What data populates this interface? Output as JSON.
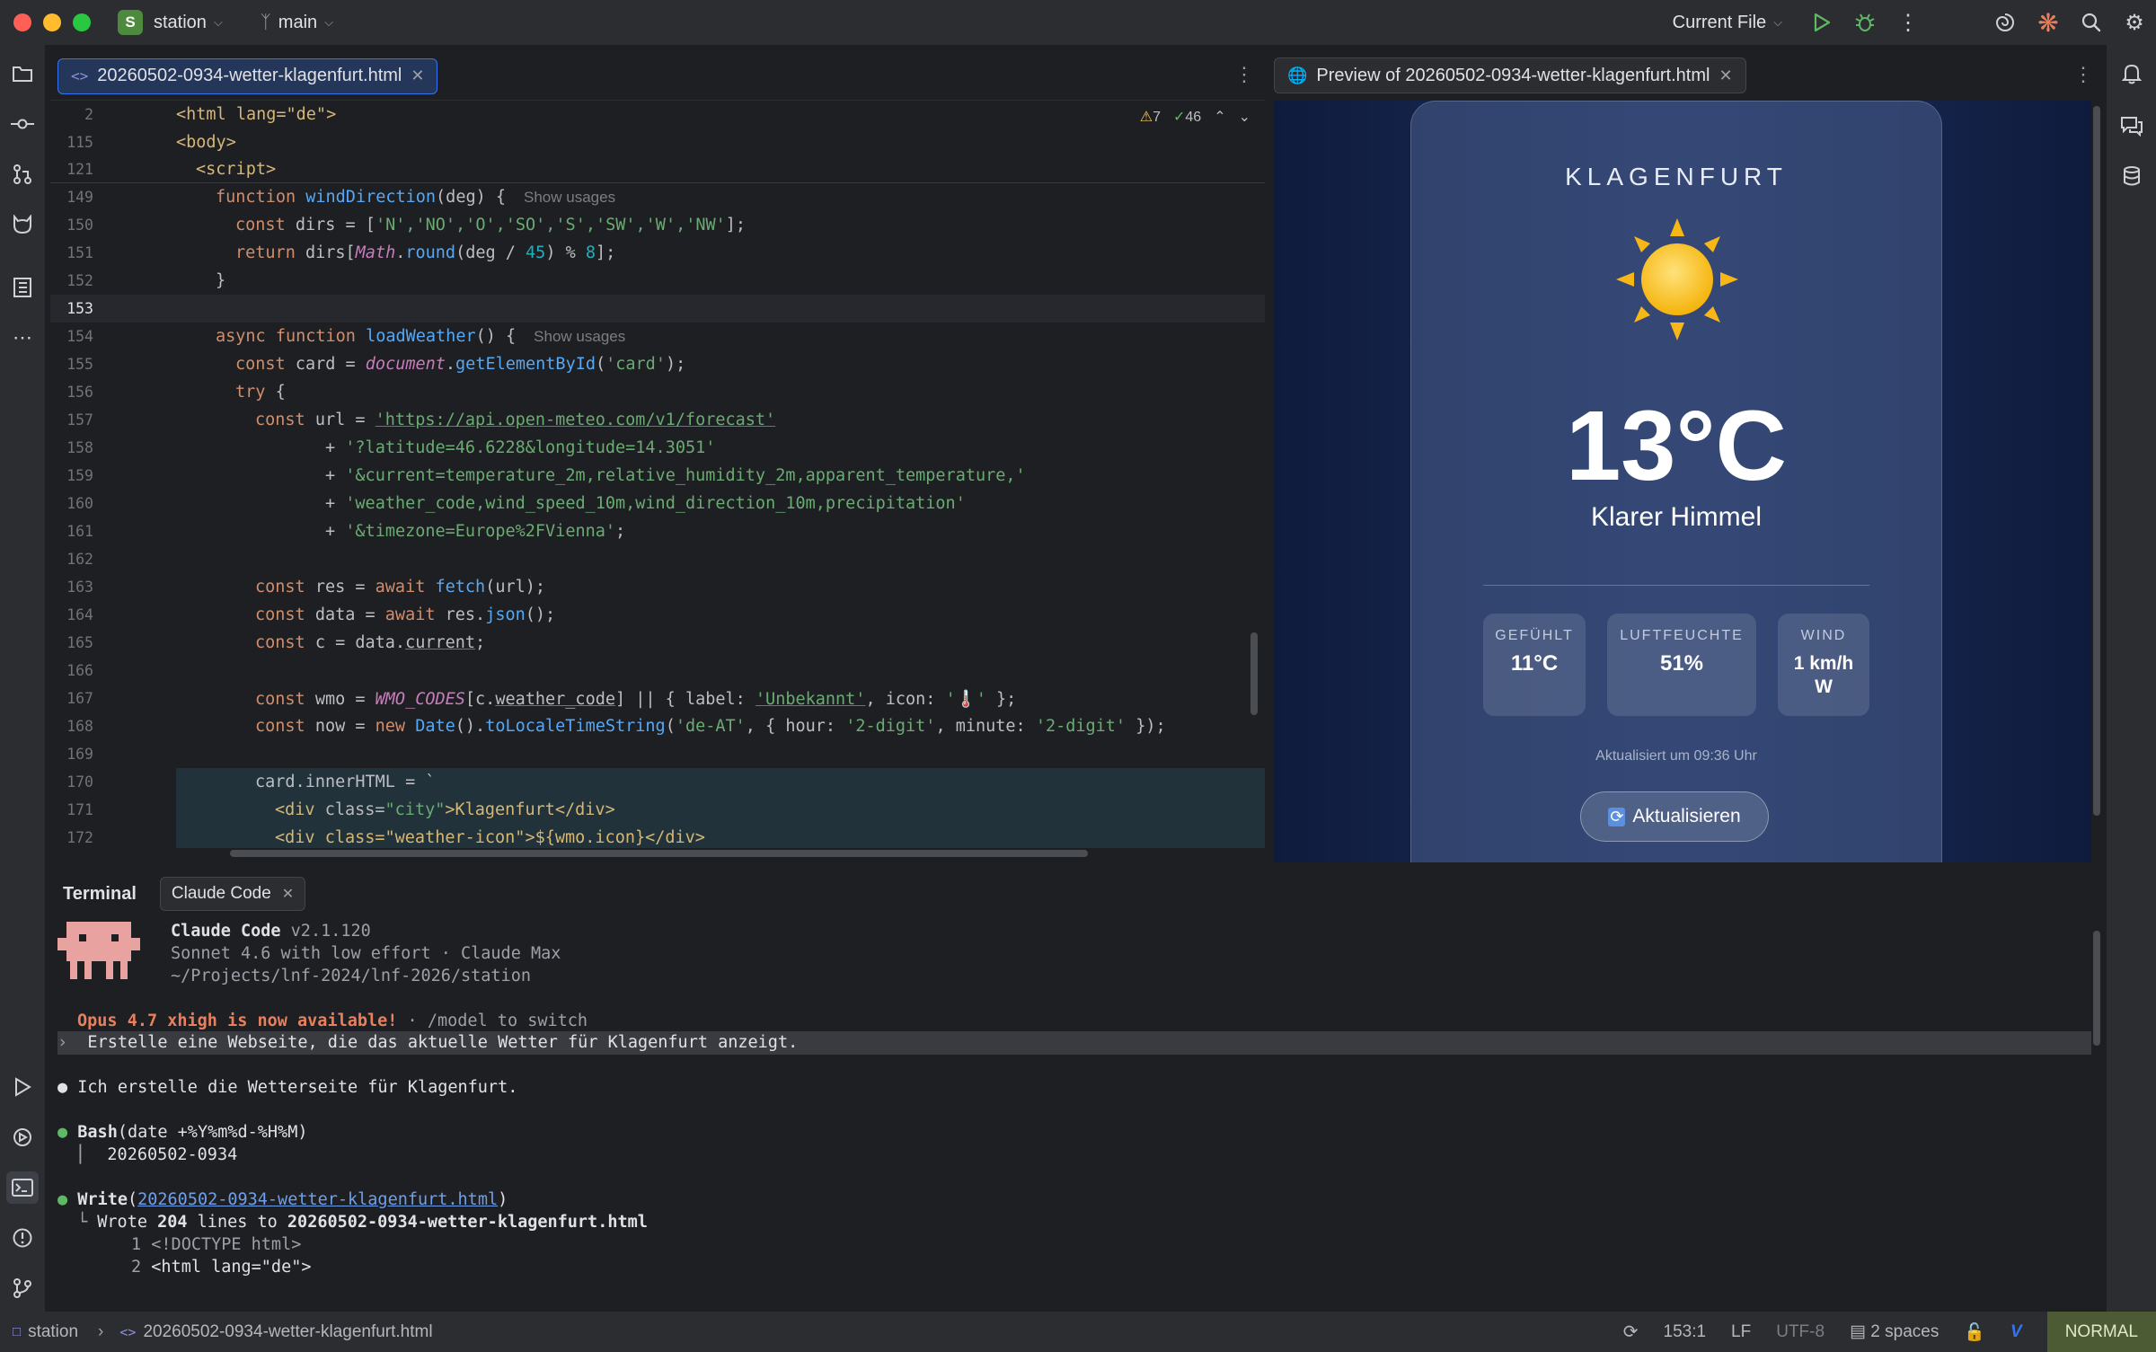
{
  "titlebar": {
    "project_badge": "S",
    "project": "station",
    "branch": "main",
    "run_config": "Current File"
  },
  "editor": {
    "tab_label": "20260502-0934-wetter-klagenfurt.html",
    "tab_icon": "<>",
    "warnings": "7",
    "checks": "46",
    "sticky": [
      {
        "ln": "2",
        "text": "<html lang=\"de\">"
      },
      {
        "ln": "115",
        "text": "<body>"
      },
      {
        "ln": "121",
        "text": "<script>"
      }
    ],
    "line_numbers": [
      "149",
      "150",
      "151",
      "152",
      "153",
      "154",
      "155",
      "156",
      "157",
      "158",
      "159",
      "160",
      "161",
      "162",
      "163",
      "164",
      "165",
      "166",
      "167",
      "168",
      "169",
      "170",
      "171",
      "172"
    ],
    "hint_show_usages": "Show usages",
    "code": {
      "l149_kw": "function ",
      "l149_fn": "windDirection",
      "l149_rest": "(deg) {",
      "l150_kw": "const ",
      "l150_rest": "dirs = [",
      "l150_items": "'N','NO','O','SO','S','SW','W','NW'",
      "l150_end": "];",
      "l151_kw": "return ",
      "l151_a": "dirs[",
      "l151_glob": "Math",
      "l151_b": ".",
      "l151_fn": "round",
      "l151_c": "(deg / ",
      "l151_num1": "45",
      "l151_d": ") % ",
      "l151_num2": "8",
      "l151_e": "];",
      "l152": "}",
      "l154_kw": "async function ",
      "l154_fn": "loadWeather",
      "l154_rest": "() {",
      "l155_kw": "const ",
      "l155_a": "card = ",
      "l155_glob": "document",
      "l155_b": ".",
      "l155_fn": "getElementById",
      "l155_c": "(",
      "l155_str": "'card'",
      "l155_d": ");",
      "l156_kw": "try ",
      "l156_rest": "{",
      "l157_kw": "const ",
      "l157_a": "url = ",
      "l157_str": "'https://api.open-meteo.com/v1/forecast'",
      "l158_a": "+ ",
      "l158_str": "'?latitude=46.6228&longitude=14.3051'",
      "l159_a": "+ ",
      "l159_str": "'&current=temperature_2m,relative_humidity_2m,apparent_temperature,'",
      "l160_a": "+ ",
      "l160_str": "'weather_code,wind_speed_10m,wind_direction_10m,precipitation'",
      "l161_a": "+ ",
      "l161_str": "'&timezone=Europe%2FVienna'",
      "l161_end": ";",
      "l163_kw": "const ",
      "l163_a": "res = ",
      "l163_kw2": "await ",
      "l163_fn": "fetch",
      "l163_b": "(url);",
      "l164_kw": "const ",
      "l164_a": "data = ",
      "l164_kw2": "await ",
      "l164_b": "res.",
      "l164_fn": "json",
      "l164_c": "();",
      "l165_kw": "const ",
      "l165_a": "c = data.",
      "l165_u": "current",
      "l165_b": ";",
      "l167_kw": "const ",
      "l167_a": "wmo = ",
      "l167_glob": "WMO_CODES",
      "l167_b": "[c.",
      "l167_u": "weather_code",
      "l167_c": "] || { label: ",
      "l167_str": "'Unbekannt'",
      "l167_d": ", icon: ",
      "l167_str2": "'🌡️'",
      "l167_e": " };",
      "l168_kw": "const ",
      "l168_a": "now = ",
      "l168_kw2": "new ",
      "l168_cls": "Date",
      "l168_b": "().",
      "l168_fn": "toLocaleTimeString",
      "l168_c": "(",
      "l168_str": "'de-AT'",
      "l168_d": ", { hour: ",
      "l168_str2": "'2-digit'",
      "l168_e": ", minute: ",
      "l168_str3": "'2-digit'",
      "l168_f": " });",
      "l170_a": "card.",
      "l170_b": "innerHTML",
      "l170_c": " = `",
      "l171_a": "<div ",
      "l171_b": "class=",
      "l171_str": "\"city\"",
      "l171_c": ">Klagenfurt</div>",
      "l172_a": "<div class=\"weather-icon\">${wmo.icon}</div>"
    }
  },
  "preview": {
    "tab_label": "Preview of 20260502-0934-wetter-klagenfurt.html",
    "city": "KLAGENFURT",
    "temperature": "13°C",
    "description": "Klarer Himmel",
    "metrics": [
      {
        "label": "GEFÜHLT",
        "value": "11°C"
      },
      {
        "label": "LUFTFEUCHTE",
        "value": "51%"
      },
      {
        "label": "WIND",
        "value": "1 km/h",
        "value2": "W"
      }
    ],
    "updated": "Aktualisiert um 09:36 Uhr",
    "refresh_label": "Aktualisieren"
  },
  "terminal": {
    "tab_terminal": "Terminal",
    "tab_claude": "Claude Code",
    "app_name": "Claude Code",
    "version": " v2.1.120",
    "model_line": "Sonnet 4.6 with low effort · Claude Max",
    "cwd": "~/Projects/lnf-2024/lnf-2026/station",
    "notice_bold": "Opus 4.7 xhigh is now available!",
    "notice_rest": " · /model to switch",
    "prompt_marker": "›",
    "prompt": "Erstelle eine Webseite, die das aktuelle Wetter für Klagenfurt anzeigt.",
    "msg1": "Ich erstelle die Wetterseite für Klagenfurt.",
    "bash_tool": "Bash",
    "bash_cmd": "(date +%Y%m%d-%H%M)",
    "bash_out": "20260502-0934",
    "write_tool": "Write",
    "write_file": "20260502-0934-wetter-klagenfurt.html",
    "write_result_a": "Wrote ",
    "write_result_n": "204",
    "write_result_b": " lines to ",
    "write_result_file": "20260502-0934-wetter-klagenfurt.html",
    "snippet1_ln": "1",
    "snippet1": "<!DOCTYPE html>",
    "snippet2_ln": "2",
    "snippet2": "<html lang=\"de\">"
  },
  "statusbar": {
    "project": "station",
    "file": "20260502-0934-wetter-klagenfurt.html",
    "position": "153:1",
    "line_sep": "LF",
    "encoding": "UTF-8",
    "indent": "2 spaces",
    "vim_mode": "NORMAL"
  },
  "colors": {
    "accent": "#3574f0",
    "keyword": "#cf8e6d",
    "function": "#56a8f5",
    "string": "#6aab73",
    "vim_mode_bg": "#4d5b35"
  }
}
